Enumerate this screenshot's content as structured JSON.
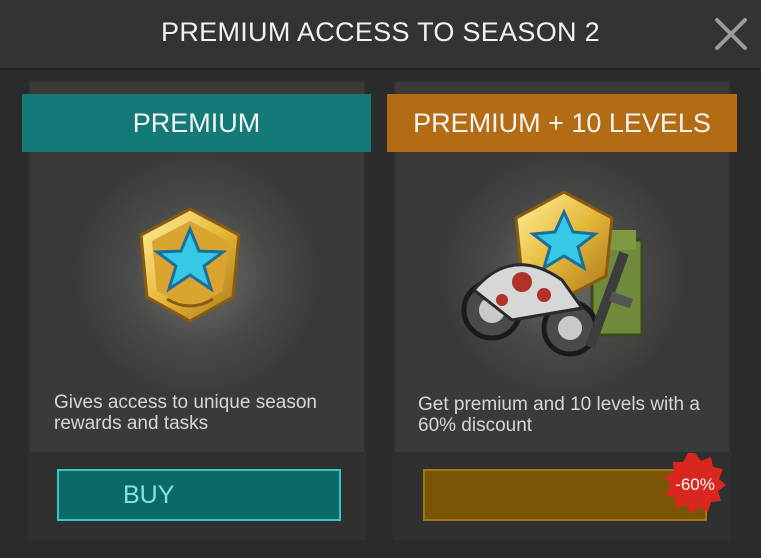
{
  "header": {
    "title": "PREMIUM ACCESS TO SEASON 2",
    "close_icon": "close-icon"
  },
  "offers": [
    {
      "title": "PREMIUM",
      "icon": "premium-star-badge-icon",
      "description_line1": "Gives access to unique season",
      "description_line2": "rewards and tasks",
      "button_label": "BUY",
      "accent": "#137a78"
    },
    {
      "title": "PREMIUM + 10 LEVELS",
      "icon": "premium-bundle-icon",
      "description_line1": "Get premium and 10 levels with a",
      "description_line2": "60% discount",
      "button_label": "",
      "discount_label": "-60%",
      "accent": "#b46c14"
    }
  ]
}
